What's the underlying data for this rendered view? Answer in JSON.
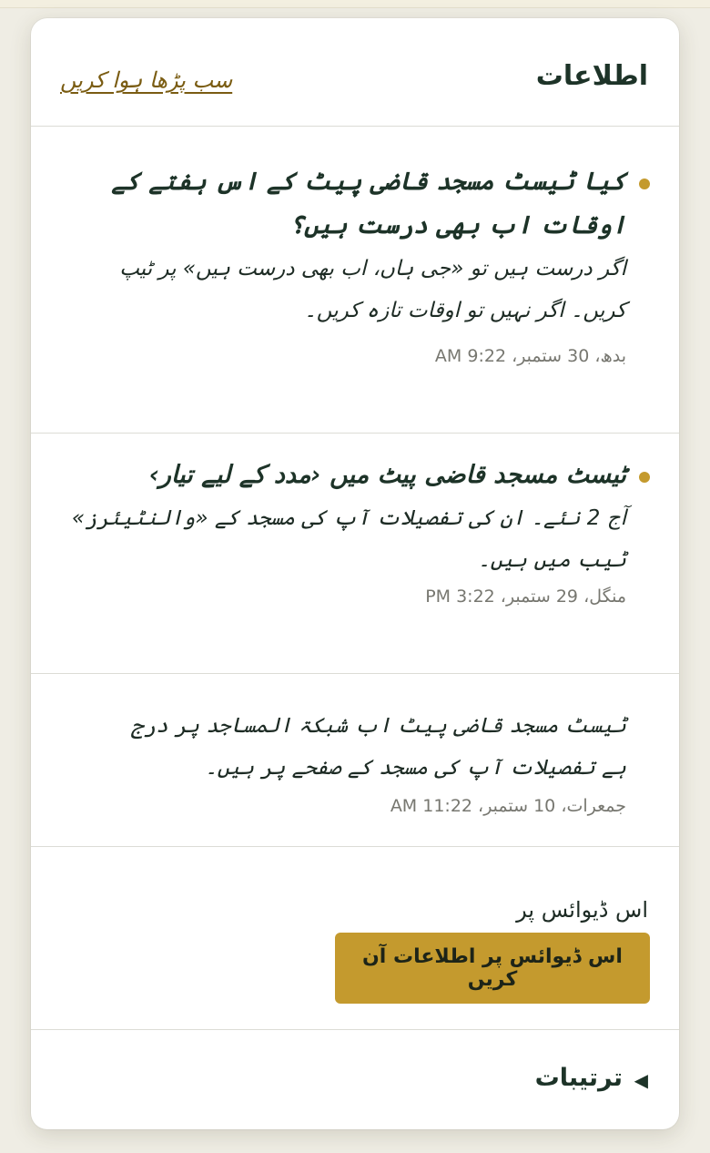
{
  "header": {
    "title": "اطلاعات",
    "mark_all_read": "سب پڑھا ہوا کریں"
  },
  "notifications": [
    {
      "unread": true,
      "title": "کیا ٹیسٹ مسجد قاضی پیٹ کے اس ہفتے کے اوقات اب بھی درست ہیں؟",
      "body": "اگر درست ہیں تو «جی ہاں، اب بھی درست ہیں» پر ٹیپ کریں۔ اگر نہیں تو اوقات تازہ کریں۔",
      "time": "بدھ، 30 ستمبر، 9:22 AM"
    },
    {
      "unread": true,
      "title": "ٹیسٹ مسجد قاضی پیٹ میں ‹مدد کے لیے تیار›",
      "body": "آج 2 نئے۔ ان کی تفصیلات آپ کی مسجد کے «والنٹیئرز» ٹیب میں ہیں۔",
      "time": "منگل، 29 ستمبر، 3:22 PM"
    },
    {
      "unread": false,
      "title": "",
      "body": "ٹیسٹ مسجد قاضی پیٹ اب شبکۃ المساجد پر درج ہے تفصیلات آپ کی مسجد کے صفحے پر ہیں۔",
      "time": "جمعرات، 10 ستمبر، 11:22 AM"
    }
  ],
  "device": {
    "label": "اس ڈیوائس پر",
    "button": "اس ڈیوائس پر اطلاعات آن کریں"
  },
  "settings": {
    "label": "ترتیبات",
    "arrow_icon": "triangle-left-icon"
  },
  "colors": {
    "accent": "#c49a2e",
    "text_dark": "#1d3328",
    "link": "#7a5c12"
  }
}
